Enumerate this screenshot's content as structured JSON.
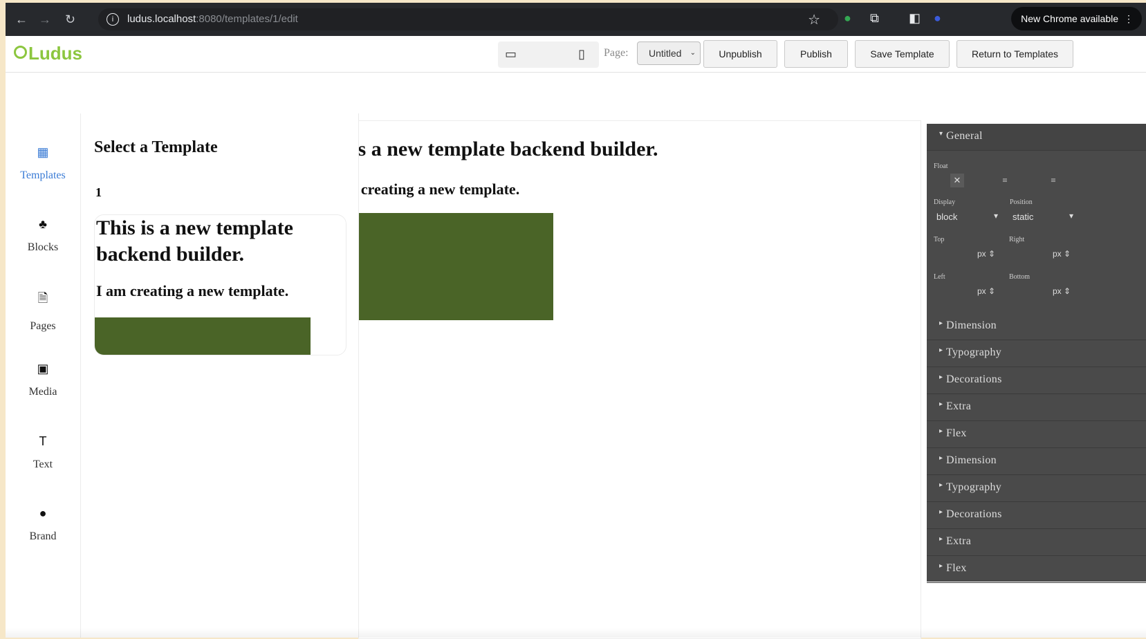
{
  "browser": {
    "url_host": "ludus.localhost",
    "url_rest": ":8080/templates/1/edit",
    "new_chrome": "New Chrome available"
  },
  "app": {
    "logo": "Ludus",
    "page_label": "Page:",
    "page_select": "Untitled",
    "buttons": {
      "unpublish": "Unpublish",
      "publish": "Publish",
      "save_template": "Save Template",
      "return_to_templates": "Return to Templates"
    }
  },
  "sidebar": {
    "items": [
      {
        "label": "Templates",
        "icon": "table-icon"
      },
      {
        "label": "Blocks",
        "icon": "shapes-icon"
      },
      {
        "label": "Pages",
        "icon": "file-icon"
      },
      {
        "label": "Media",
        "icon": "image-icon"
      },
      {
        "label": "Text",
        "icon": "text-icon"
      },
      {
        "label": "Brand",
        "icon": "tag-icon"
      }
    ]
  },
  "templates_panel": {
    "title": "Select a Template",
    "template_number": "1",
    "card_heading": "This is a new template backend builder.",
    "card_subheading": "I am creating a new template."
  },
  "canvas": {
    "heading": "This is a new template backend builder.",
    "subheading": "I am creating a new template.",
    "block_color": "#4a6427"
  },
  "style_manager": {
    "general": "General",
    "float_label": "Float",
    "display_label": "Display",
    "display_value": "block",
    "position_label": "Position",
    "position_value": "static",
    "top_label": "Top",
    "right_label": "Right",
    "left_label": "Left",
    "bottom_label": "Bottom",
    "unit": "px",
    "sections": [
      "Dimension",
      "Typography",
      "Decorations",
      "Extra",
      "Flex",
      "Dimension",
      "Typography",
      "Decorations",
      "Extra",
      "Flex"
    ]
  }
}
